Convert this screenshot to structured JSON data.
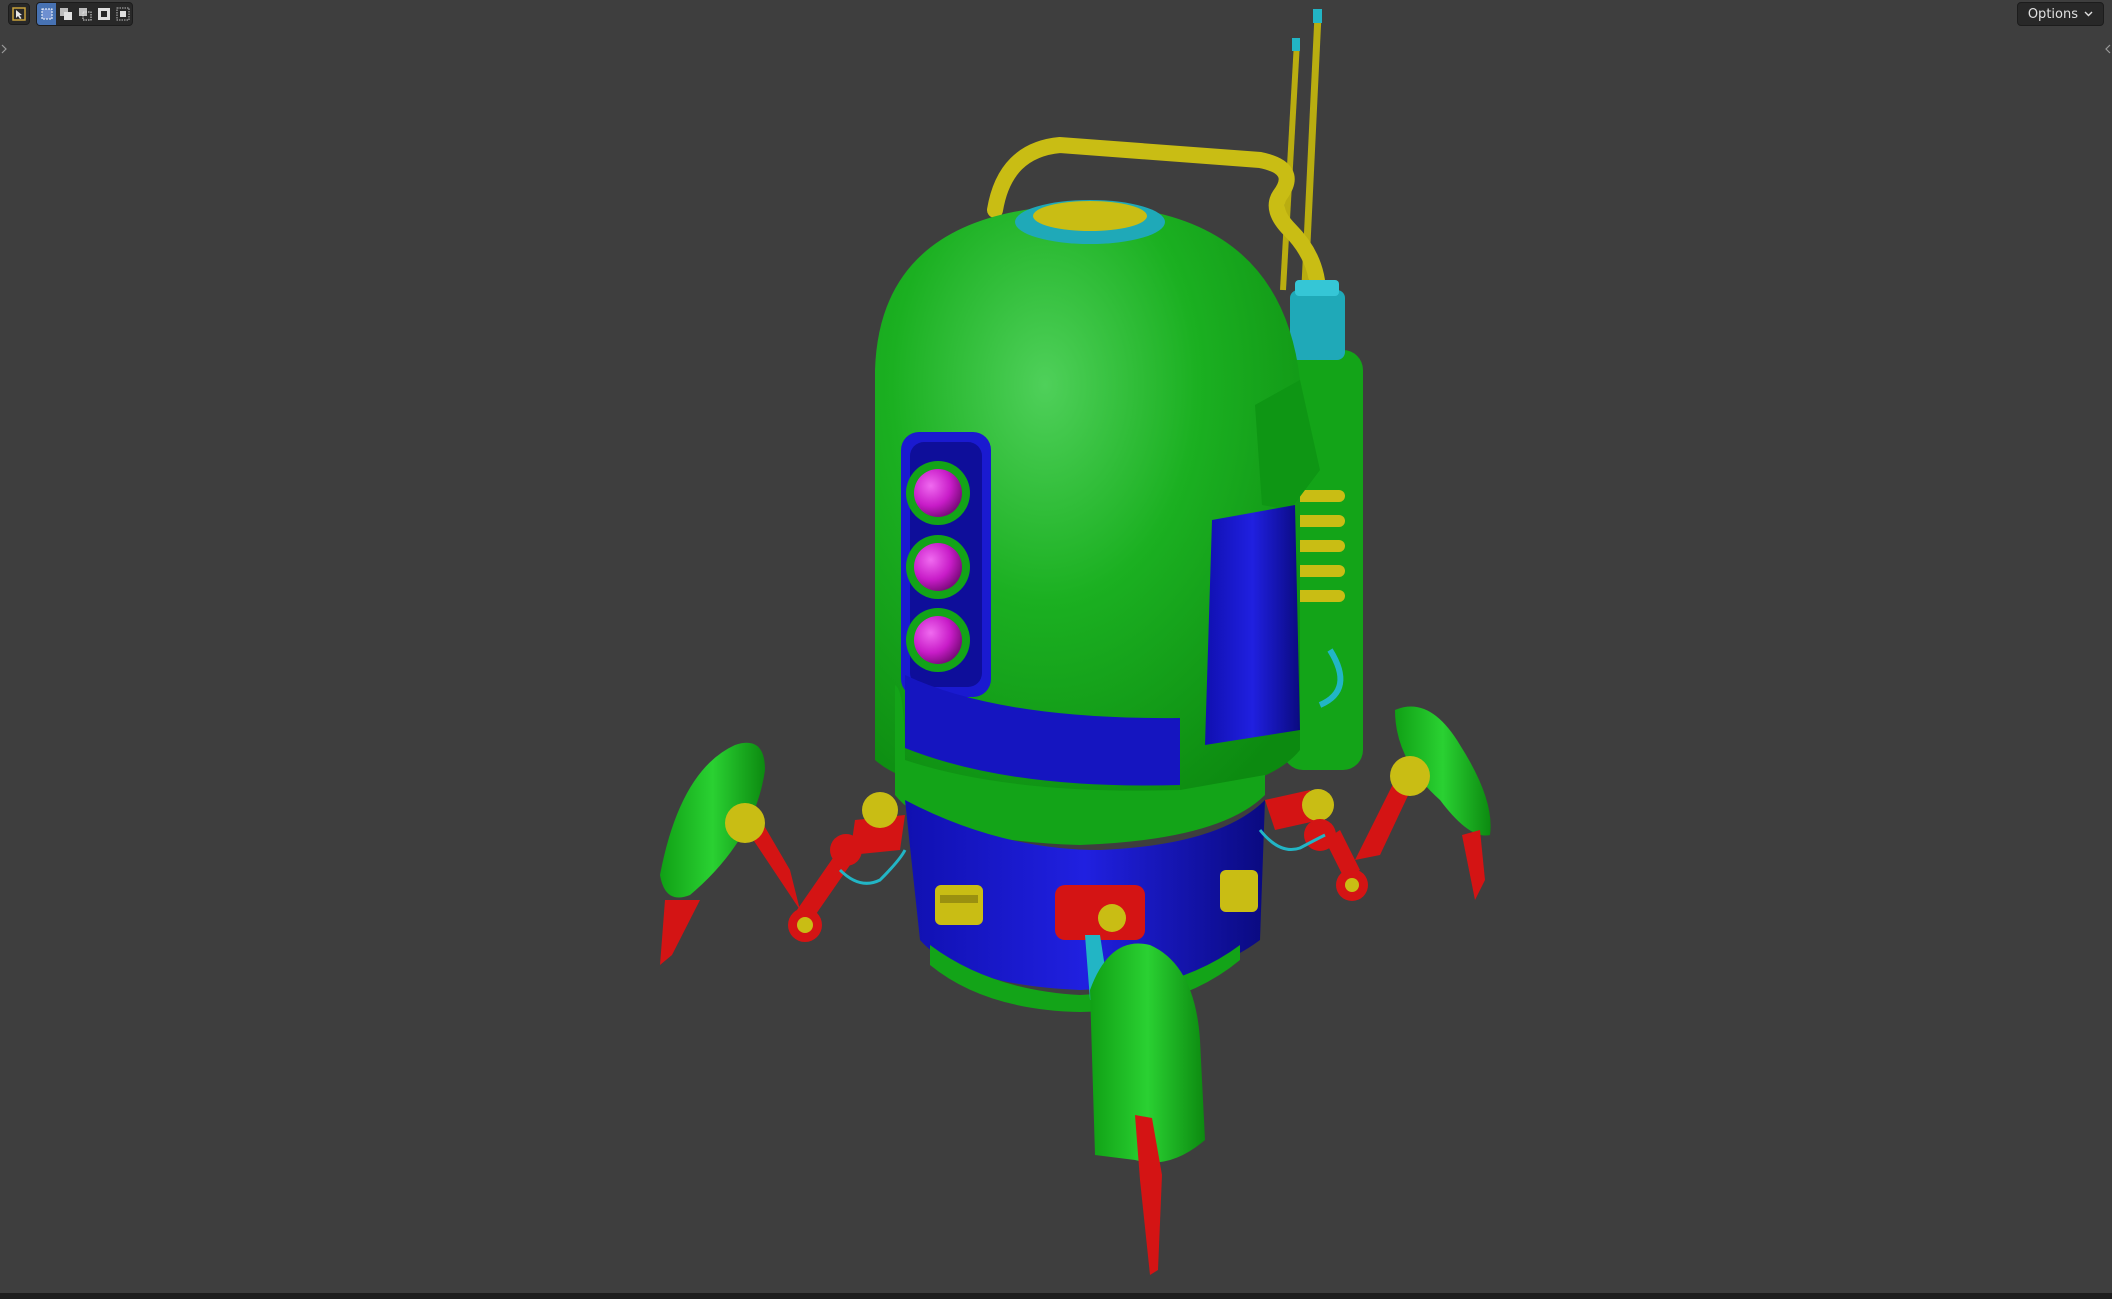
{
  "viewport": {
    "background": "#3e3e3e",
    "tool_icon": "select-cursor-icon",
    "selection_modes": [
      {
        "name": "mode-new-icon",
        "active": true
      },
      {
        "name": "mode-extend-icon",
        "active": false
      },
      {
        "name": "mode-subtract-icon",
        "active": false
      },
      {
        "name": "mode-difference-icon",
        "active": false
      },
      {
        "name": "mode-intersect-icon",
        "active": false
      }
    ],
    "options_label": "Options",
    "options_icon": "chevron-down-icon"
  },
  "model": {
    "subject": "robot-drone",
    "colors": {
      "body": "#15b01a",
      "body_shade": "#0e8a12",
      "panel": "#1616c8",
      "panel_shade": "#0c0c8c",
      "joint": "#d41414",
      "joint_shade": "#8c0a0a",
      "trim": "#cfc21a",
      "cable": "#22b5c5",
      "light": "#cc1ccc"
    }
  }
}
